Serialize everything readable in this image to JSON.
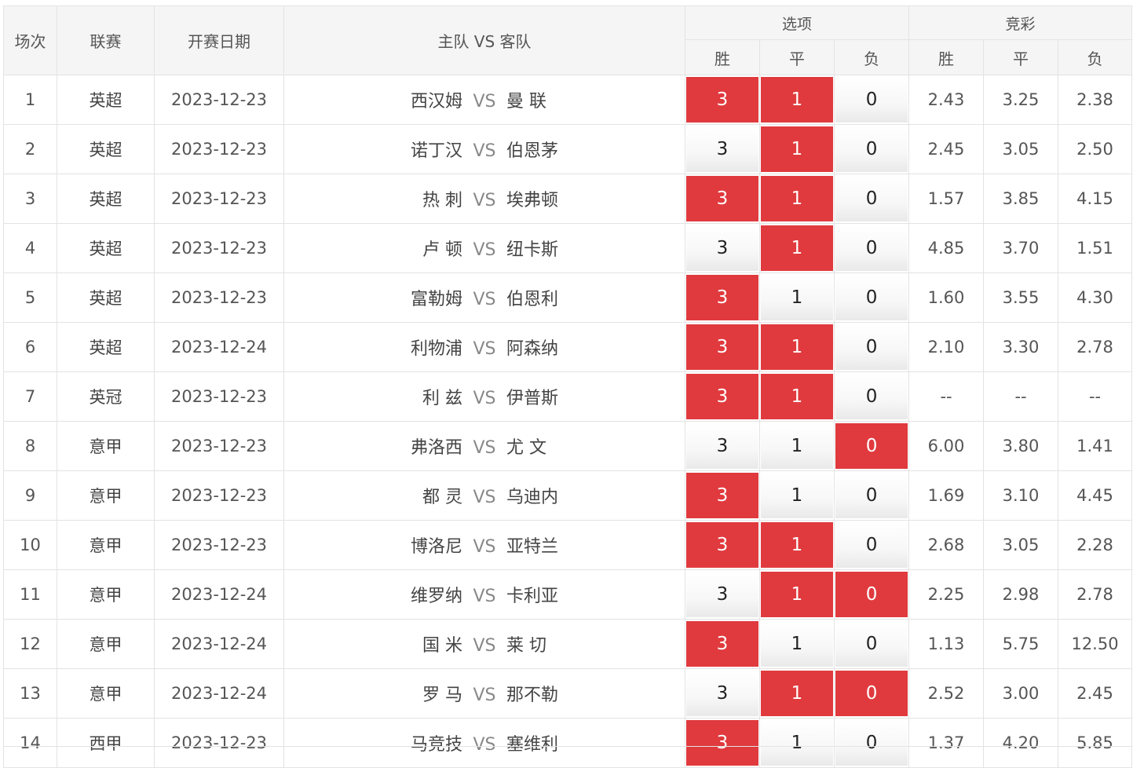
{
  "headers": {
    "index": "场次",
    "league": "联赛",
    "date": "开赛日期",
    "match": "主队 VS 客队",
    "options_group": "选项",
    "odds_group": "竞彩",
    "win": "胜",
    "draw": "平",
    "lose": "负"
  },
  "vs_label": "VS",
  "colors": {
    "selected": "#e03a3e",
    "header_bg": "#f5f5f5"
  },
  "rows": [
    {
      "index": "1",
      "league": "英超",
      "date": "2023-12-23",
      "home": "西汉姆",
      "away": "曼 联",
      "opts": [
        "3",
        "1",
        "0"
      ],
      "sel": [
        true,
        true,
        false
      ],
      "odds": [
        "2.43",
        "3.25",
        "2.38"
      ]
    },
    {
      "index": "2",
      "league": "英超",
      "date": "2023-12-23",
      "home": "诺丁汉",
      "away": "伯恩茅",
      "opts": [
        "3",
        "1",
        "0"
      ],
      "sel": [
        false,
        true,
        false
      ],
      "odds": [
        "2.45",
        "3.05",
        "2.50"
      ]
    },
    {
      "index": "3",
      "league": "英超",
      "date": "2023-12-23",
      "home": "热 刺",
      "away": "埃弗顿",
      "opts": [
        "3",
        "1",
        "0"
      ],
      "sel": [
        true,
        true,
        false
      ],
      "odds": [
        "1.57",
        "3.85",
        "4.15"
      ]
    },
    {
      "index": "4",
      "league": "英超",
      "date": "2023-12-23",
      "home": "卢 顿",
      "away": "纽卡斯",
      "opts": [
        "3",
        "1",
        "0"
      ],
      "sel": [
        false,
        true,
        false
      ],
      "odds": [
        "4.85",
        "3.70",
        "1.51"
      ]
    },
    {
      "index": "5",
      "league": "英超",
      "date": "2023-12-23",
      "home": "富勒姆",
      "away": "伯恩利",
      "opts": [
        "3",
        "1",
        "0"
      ],
      "sel": [
        true,
        false,
        false
      ],
      "odds": [
        "1.60",
        "3.55",
        "4.30"
      ]
    },
    {
      "index": "6",
      "league": "英超",
      "date": "2023-12-24",
      "home": "利物浦",
      "away": "阿森纳",
      "opts": [
        "3",
        "1",
        "0"
      ],
      "sel": [
        true,
        true,
        false
      ],
      "odds": [
        "2.10",
        "3.30",
        "2.78"
      ]
    },
    {
      "index": "7",
      "league": "英冠",
      "date": "2023-12-23",
      "home": "利 兹",
      "away": "伊普斯",
      "opts": [
        "3",
        "1",
        "0"
      ],
      "sel": [
        true,
        true,
        false
      ],
      "odds": [
        "--",
        "--",
        "--"
      ]
    },
    {
      "index": "8",
      "league": "意甲",
      "date": "2023-12-23",
      "home": "弗洛西",
      "away": "尤 文",
      "opts": [
        "3",
        "1",
        "0"
      ],
      "sel": [
        false,
        false,
        true
      ],
      "odds": [
        "6.00",
        "3.80",
        "1.41"
      ]
    },
    {
      "index": "9",
      "league": "意甲",
      "date": "2023-12-23",
      "home": "都 灵",
      "away": "乌迪内",
      "opts": [
        "3",
        "1",
        "0"
      ],
      "sel": [
        true,
        false,
        false
      ],
      "odds": [
        "1.69",
        "3.10",
        "4.45"
      ]
    },
    {
      "index": "10",
      "league": "意甲",
      "date": "2023-12-23",
      "home": "博洛尼",
      "away": "亚特兰",
      "opts": [
        "3",
        "1",
        "0"
      ],
      "sel": [
        true,
        true,
        false
      ],
      "odds": [
        "2.68",
        "3.05",
        "2.28"
      ]
    },
    {
      "index": "11",
      "league": "意甲",
      "date": "2023-12-24",
      "home": "维罗纳",
      "away": "卡利亚",
      "opts": [
        "3",
        "1",
        "0"
      ],
      "sel": [
        false,
        true,
        true
      ],
      "odds": [
        "2.25",
        "2.98",
        "2.78"
      ]
    },
    {
      "index": "12",
      "league": "意甲",
      "date": "2023-12-24",
      "home": "国 米",
      "away": "莱 切",
      "opts": [
        "3",
        "1",
        "0"
      ],
      "sel": [
        true,
        false,
        false
      ],
      "odds": [
        "1.13",
        "5.75",
        "12.50"
      ]
    },
    {
      "index": "13",
      "league": "意甲",
      "date": "2023-12-24",
      "home": "罗 马",
      "away": "那不勒",
      "opts": [
        "3",
        "1",
        "0"
      ],
      "sel": [
        false,
        true,
        true
      ],
      "odds": [
        "2.52",
        "3.00",
        "2.45"
      ]
    },
    {
      "index": "14",
      "league": "西甲",
      "date": "2023-12-23",
      "home": "马竞技",
      "away": "塞维利",
      "opts": [
        "3",
        "1",
        "0"
      ],
      "sel": [
        true,
        false,
        false
      ],
      "odds": [
        "1.37",
        "4.20",
        "5.85"
      ]
    }
  ]
}
